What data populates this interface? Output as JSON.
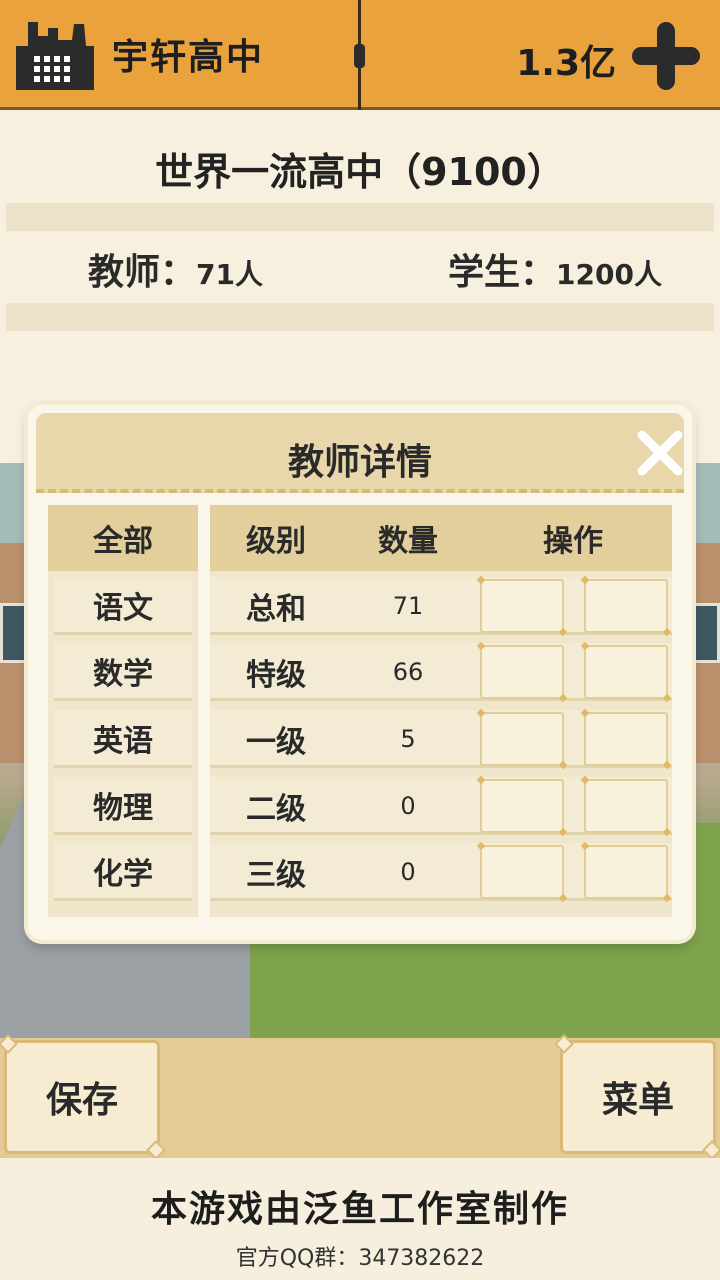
{
  "header": {
    "school_name": "宇轩高中",
    "money": "1.3亿",
    "icons": {
      "school": "factory-icon",
      "add": "plus-icon"
    }
  },
  "info": {
    "rank_title": "世界一流高中（9100）",
    "teachers_label": "教师：",
    "teachers_value": "71人",
    "students_label": "学生：",
    "students_value": "1200人"
  },
  "modal": {
    "title": "教师详情",
    "close_icon": "close-icon",
    "left_header": "全部",
    "subjects": [
      "语文",
      "数学",
      "英语",
      "物理",
      "化学"
    ],
    "columns": {
      "level": "级别",
      "count": "数量",
      "action": "操作"
    },
    "rows": [
      {
        "level": "总和",
        "count": "71"
      },
      {
        "level": "特级",
        "count": "66"
      },
      {
        "level": "一级",
        "count": "5"
      },
      {
        "level": "二级",
        "count": "0"
      },
      {
        "level": "三级",
        "count": "0"
      }
    ]
  },
  "buttons": {
    "save": "保存",
    "menu": "菜单"
  },
  "footer": {
    "credit": "本游戏由泛鱼工作室制作",
    "qq_group": "官方QQ群：347382622"
  },
  "colors": {
    "topbar": "#eaa23d",
    "panel": "#f7f0de",
    "accent_tan": "#e2cf9b"
  }
}
